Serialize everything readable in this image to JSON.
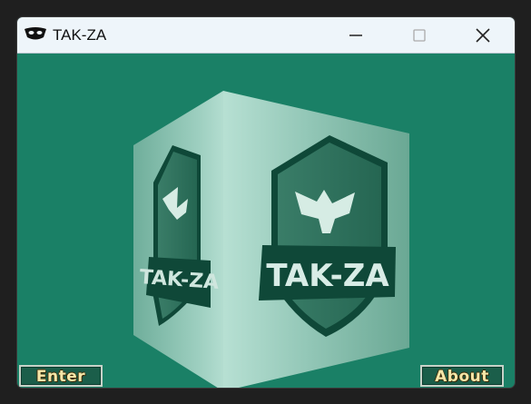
{
  "window": {
    "title": "TAK-ZA",
    "controls": [
      "minimize-icon",
      "maximize-icon",
      "close-icon"
    ]
  },
  "scene": {
    "cube_logo_text": "TAK-ZA",
    "colors": {
      "background": "#1a8066",
      "cube_light": "#a8d6c8",
      "cube_dark": "#5fa892",
      "shield": "#2b6b57",
      "shield_dark": "#0f4838",
      "text": "#d8ece6"
    }
  },
  "buttons": {
    "enter_label": "Enter",
    "about_label": "About"
  }
}
